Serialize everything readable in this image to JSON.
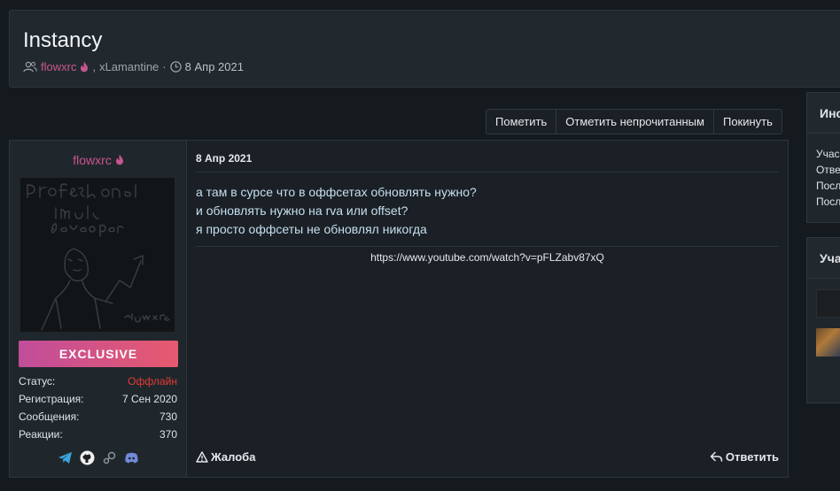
{
  "thread": {
    "title": "Instancy",
    "author": "flowxrc",
    "participant": "xLamantine",
    "separator": "·",
    "date": "8 Апр 2021"
  },
  "actions": [
    "Пометить",
    "Отметить непрочитанным",
    "Покинуть"
  ],
  "post": {
    "username": "flowxrc",
    "badge": "EXCLUSIVE",
    "stats": [
      {
        "label": "Статус:",
        "value": "Оффлайн"
      },
      {
        "label": "Регистрация:",
        "value": "7 Сен 2020"
      },
      {
        "label": "Сообщения:",
        "value": "730"
      },
      {
        "label": "Реакции:",
        "value": "370"
      }
    ],
    "date": "8 Апр 2021",
    "lines": [
      "а там в сурсе что в оффсетах обновлять нужно?",
      "и обновлять нужно на rva или offset?",
      "я просто оффсеты не обновлял никогда"
    ],
    "link": "https://www.youtube.com/watch?v=pFLZabv87xQ",
    "report_label": "Жалоба",
    "reply_label": "Ответить"
  },
  "right": {
    "info_head": "Инс",
    "info_items": [
      "Учас",
      "Отве",
      "Посл",
      "Посл"
    ],
    "participants_head": "Уча"
  },
  "colors": {
    "accent": "#c8558f",
    "offline": "#e53935",
    "badge_start": "#c14d9a",
    "badge_end": "#e65a6f"
  }
}
